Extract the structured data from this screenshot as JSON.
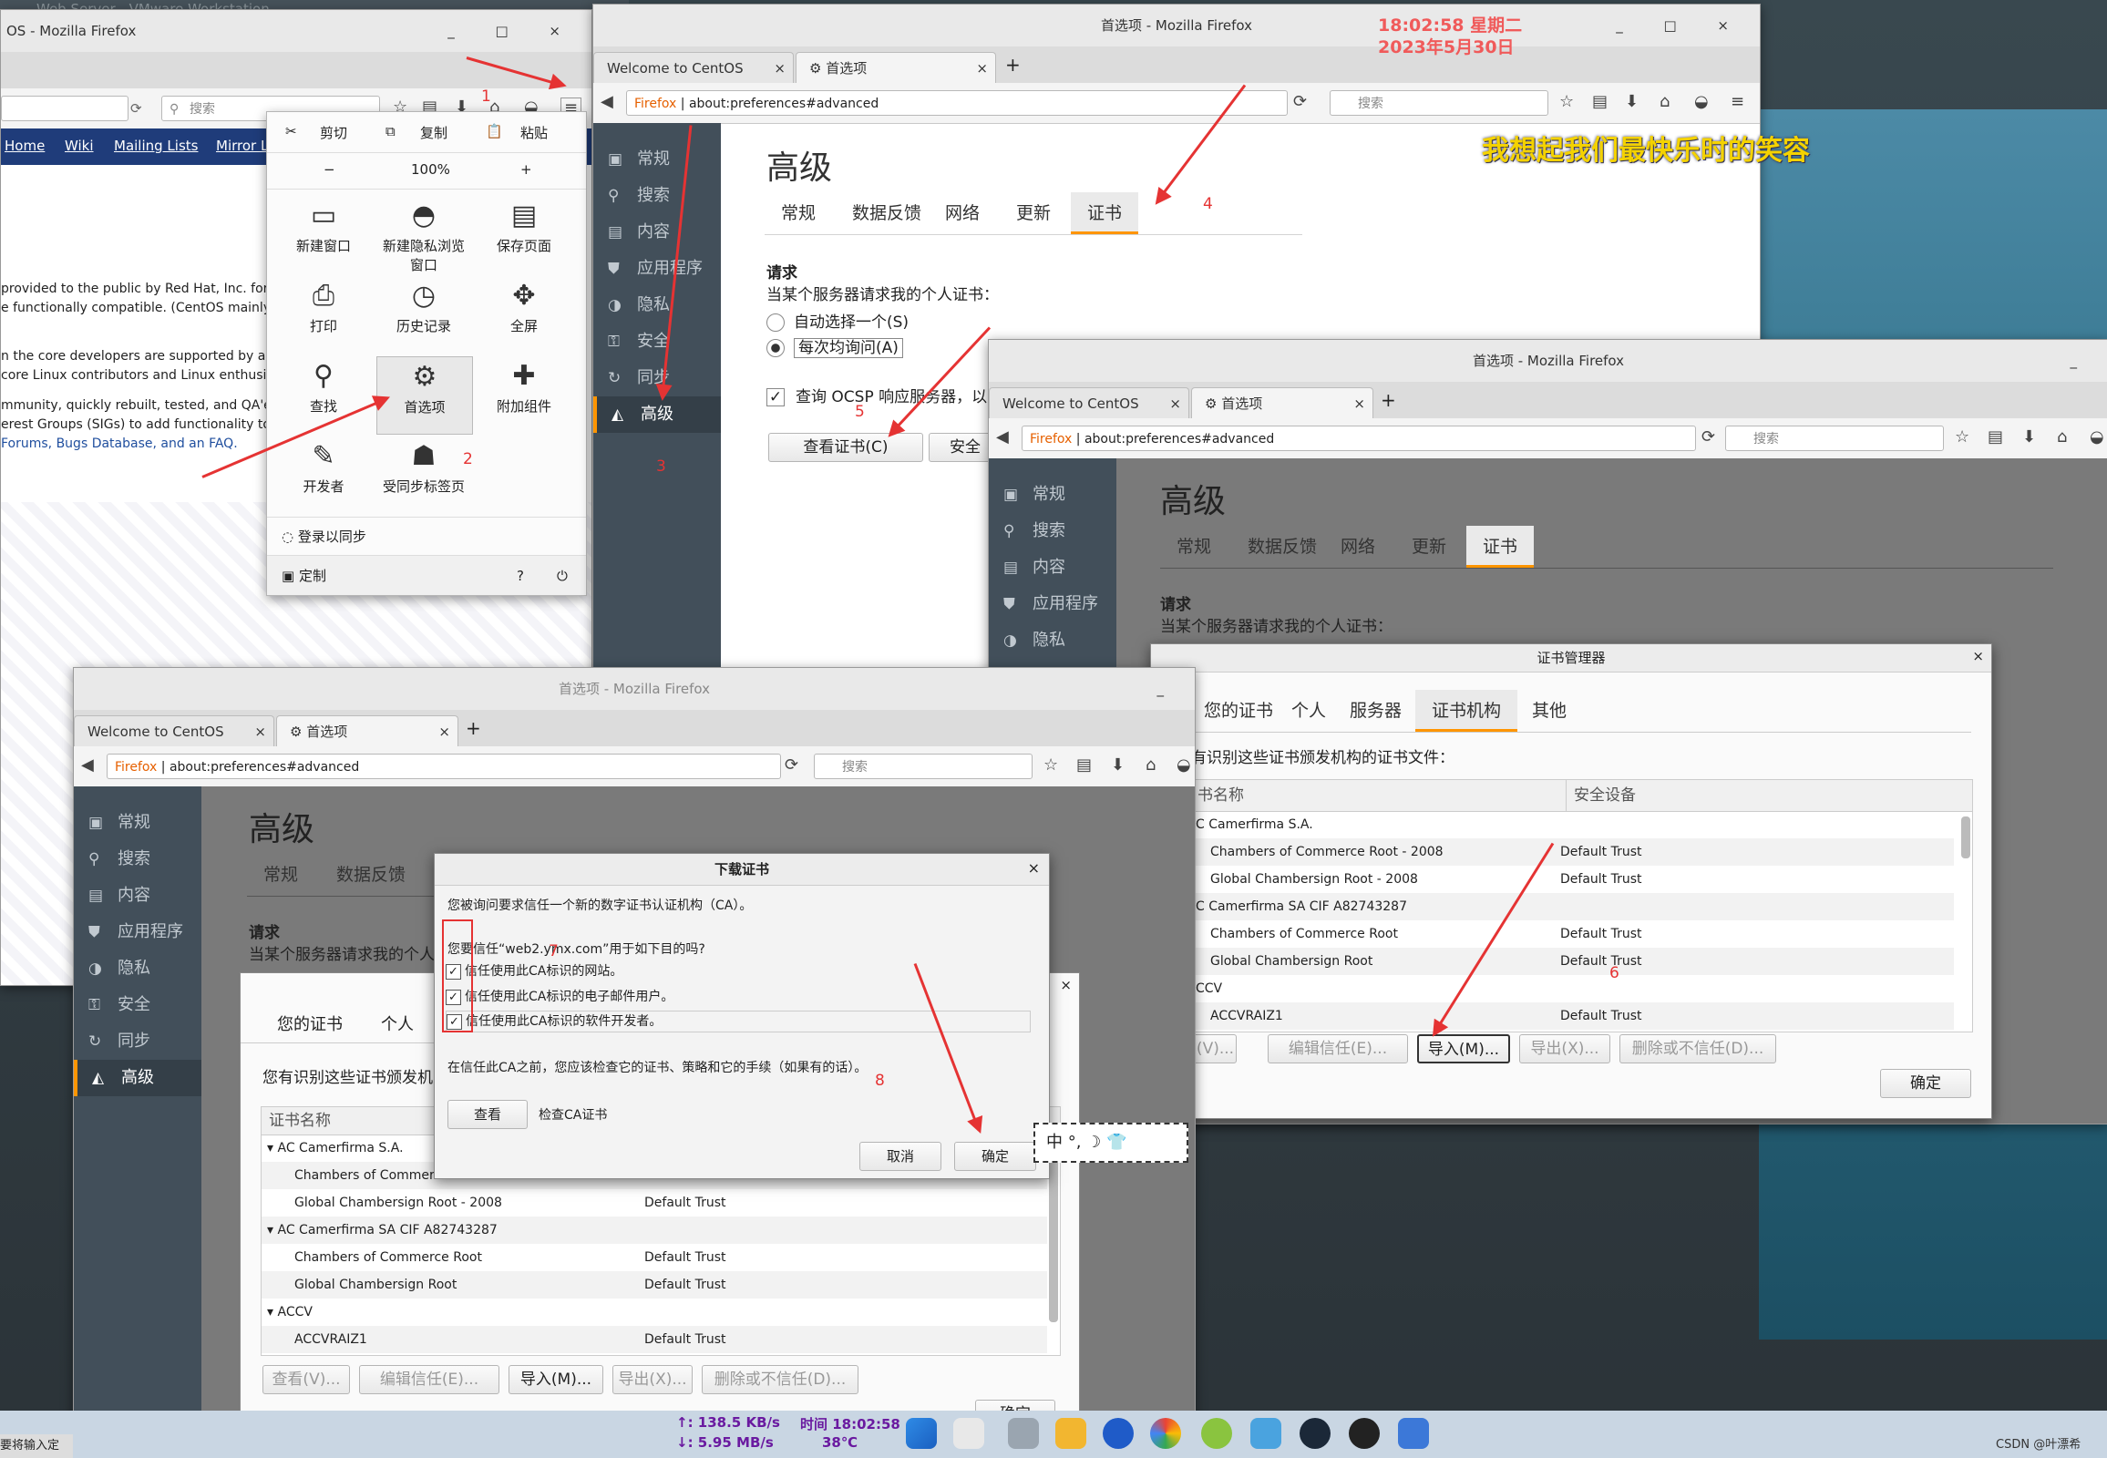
{
  "clock_overlay": {
    "time": "18:02:58 星期二",
    "date": "2023年5月30日"
  },
  "banner_text": "我想起我们最快乐时的笑容",
  "vmware_title": "Web Server - VMware Workstation",
  "win1": {
    "title": "OS - Mozilla Firefox",
    "search_placeholder": "搜索",
    "nav_links": [
      "Home",
      "Wiki",
      "Mailing Lists",
      "Mirror L"
    ],
    "body_lines": [
      "provided to the public by Red Hat, Inc. for",
      "e functionally compatible. (CentOS mainly",
      "n the core developers are supported by a",
      "core Linux contributors and Linux enthusi",
      "mmunity, quickly rebuilt, tested, and QA'e",
      "erest Groups (SIGs) to add functionality to",
      "Forums, Bugs Database, and an FAQ."
    ]
  },
  "menu": {
    "cut": "剪切",
    "copy": "复制",
    "paste": "粘贴",
    "zoom_minus": "−",
    "zoom": "100%",
    "zoom_plus": "+",
    "items": [
      {
        "label": "新建窗口",
        "icon": "▭"
      },
      {
        "label": "新建隐私浏览窗口",
        "icon": "◓"
      },
      {
        "label": "保存页面",
        "icon": "▤"
      },
      {
        "label": "打印",
        "icon": "⎙"
      },
      {
        "label": "历史记录",
        "icon": "◷"
      },
      {
        "label": "全屏",
        "icon": "✥"
      },
      {
        "label": "查找",
        "icon": "⚲"
      },
      {
        "label": "首选项",
        "icon": "⚙"
      },
      {
        "label": "附加组件",
        "icon": "✚"
      },
      {
        "label": "开发者",
        "icon": "✎"
      },
      {
        "label": "受同步标签页",
        "icon": "☗"
      }
    ],
    "sync": "登录以同步",
    "customize": "定制"
  },
  "prefs": {
    "title": "首选项 - Mozilla Firefox",
    "tab_welcome": "Welcome to CentOS",
    "tab_prefs": "首选项",
    "url_prefix": "Firefox",
    "url": "about:preferences#advanced",
    "search": "搜索",
    "sidebar": [
      "常规",
      "搜索",
      "内容",
      "应用程序",
      "隐私",
      "安全",
      "同步",
      "高级"
    ],
    "heading": "高级",
    "subtabs": [
      "常规",
      "数据反馈",
      "网络",
      "更新",
      "证书"
    ],
    "request_heading": "请求",
    "request_text": "当某个服务器请求我的个人证书：",
    "radio_auto": "自动选择一个(S)",
    "radio_ask": "每次均询问(A)",
    "ocsp": "查询 OCSP 响应服务器，以",
    "view_certs": "查看证书(C)",
    "security_dev": "安全"
  },
  "certmgr": {
    "title": "证书管理器",
    "tabs": [
      "您的证书",
      "个人",
      "服务器",
      "证书机构",
      "其他"
    ],
    "desc": "有识别这些证书颁发机构的证书文件：",
    "col_name": "书名称",
    "col_dev": "安全设备",
    "rows": [
      {
        "name": "C Camerfirma S.A.",
        "dev": ""
      },
      {
        "name": "Chambers of Commerce Root - 2008",
        "dev": "Default Trust"
      },
      {
        "name": "Global Chambersign Root - 2008",
        "dev": "Default Trust"
      },
      {
        "name": "C Camerfirma SA CIF A82743287",
        "dev": ""
      },
      {
        "name": "Chambers of Commerce Root",
        "dev": "Default Trust"
      },
      {
        "name": "Global Chambersign Root",
        "dev": "Default Trust"
      },
      {
        "name": "CCV",
        "dev": ""
      },
      {
        "name": "ACCVRAIZ1",
        "dev": "Default Trust"
      }
    ],
    "btn_view": "看(V)...",
    "btn_edit": "编辑信任(E)...",
    "btn_import": "导入(M)...",
    "btn_export": "导出(X)...",
    "btn_delete": "删除或不信任(D)...",
    "btn_ok": "确定"
  },
  "win4": {
    "title": "首选项 - Mozilla Firefox",
    "your_certs": "您的证书",
    "personal": "个人",
    "desc": "您有识别这些证书颁发机",
    "col_name": "证书名称",
    "rows": [
      {
        "name": "AC Camerfirma S.A.",
        "dev": "",
        "group": true
      },
      {
        "name": "Chambers of Commerce",
        "dev": "",
        "group": false
      },
      {
        "name": "Global Chambersign Root - 2008",
        "dev": "Default Trust",
        "group": false
      },
      {
        "name": "AC Camerfirma SA CIF A82743287",
        "dev": "",
        "group": true
      },
      {
        "name": "Chambers of Commerce Root",
        "dev": "Default Trust",
        "group": false
      },
      {
        "name": "Global Chambersign Root",
        "dev": "Default Trust",
        "group": false
      },
      {
        "name": "ACCV",
        "dev": "",
        "group": true
      },
      {
        "name": "ACCVRAIZ1",
        "dev": "Default Trust",
        "group": false
      }
    ],
    "btn_view": "查看(V)...",
    "btn_edit": "编辑信任(E)...",
    "btn_import": "导入(M)...",
    "btn_export": "导出(X)...",
    "btn_delete": "删除或不信任(D)...",
    "btn_ok": "确定"
  },
  "download": {
    "title": "下载证书",
    "line1": "您被询问要求信任一个新的数字证书认证机构（CA）。",
    "line2": "您要信任“web2.ymx.com”用于如下目的吗?",
    "chk1": "信任使用此CA标识的网站。",
    "chk2": "信任使用此CA标识的电子邮件用户。",
    "chk3": "信任使用此CA标识的软件开发者。",
    "line3": "在信任此CA之前，您应该检查它的证书、策略和它的手续（如果有的话）。",
    "view": "查看",
    "view_hint": "检查CA证书",
    "cancel": "取消",
    "ok": "确定"
  },
  "ime": "中 °, ☽ 👕",
  "step_numbers": [
    "1",
    "2",
    "3",
    "4",
    "5",
    "6",
    "7",
    "8"
  ],
  "taskbar": {
    "upload": "↑: 138.5 KB/s",
    "download": "↓: 5.95 MB/s",
    "time": "时间 18:02:58",
    "temp": "38℃",
    "ime_hint": "要将输入定",
    "watermark": "CSDN @叶漂希"
  }
}
